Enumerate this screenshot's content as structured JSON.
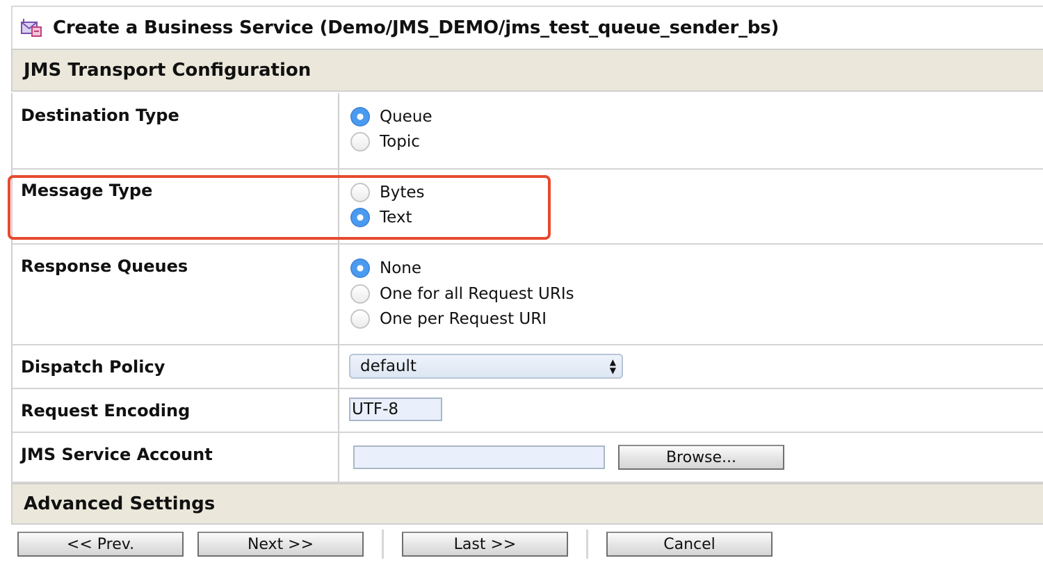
{
  "title": "Create a Business Service (Demo/JMS_DEMO/jms_test_queue_sender_bs)",
  "icons": {
    "title_icon": "business-service-icon"
  },
  "section_jms": "JMS Transport Configuration",
  "section_advanced": "Advanced Settings",
  "destination_type": {
    "label": "Destination Type",
    "options": [
      "Queue",
      "Topic"
    ],
    "selected": "Queue"
  },
  "message_type": {
    "label": "Message Type",
    "options": [
      "Bytes",
      "Text"
    ],
    "selected": "Text"
  },
  "response_queues": {
    "label": "Response Queues",
    "options": [
      "None",
      "One for all Request URIs",
      "One per Request URI"
    ],
    "selected": "None"
  },
  "dispatch_policy": {
    "label": "Dispatch Policy",
    "value": "default"
  },
  "request_encoding": {
    "label": "Request Encoding",
    "value": "UTF-8"
  },
  "jms_service_account": {
    "label": "JMS Service Account",
    "value": "",
    "browse_label": "Browse..."
  },
  "buttons": {
    "prev": "<< Prev.",
    "next": "Next >>",
    "last": "Last >>",
    "cancel": "Cancel"
  },
  "colors": {
    "highlight": "#e64a2e",
    "section_bg": "#ebe8db",
    "radio_selected": "#4a9bf0"
  }
}
